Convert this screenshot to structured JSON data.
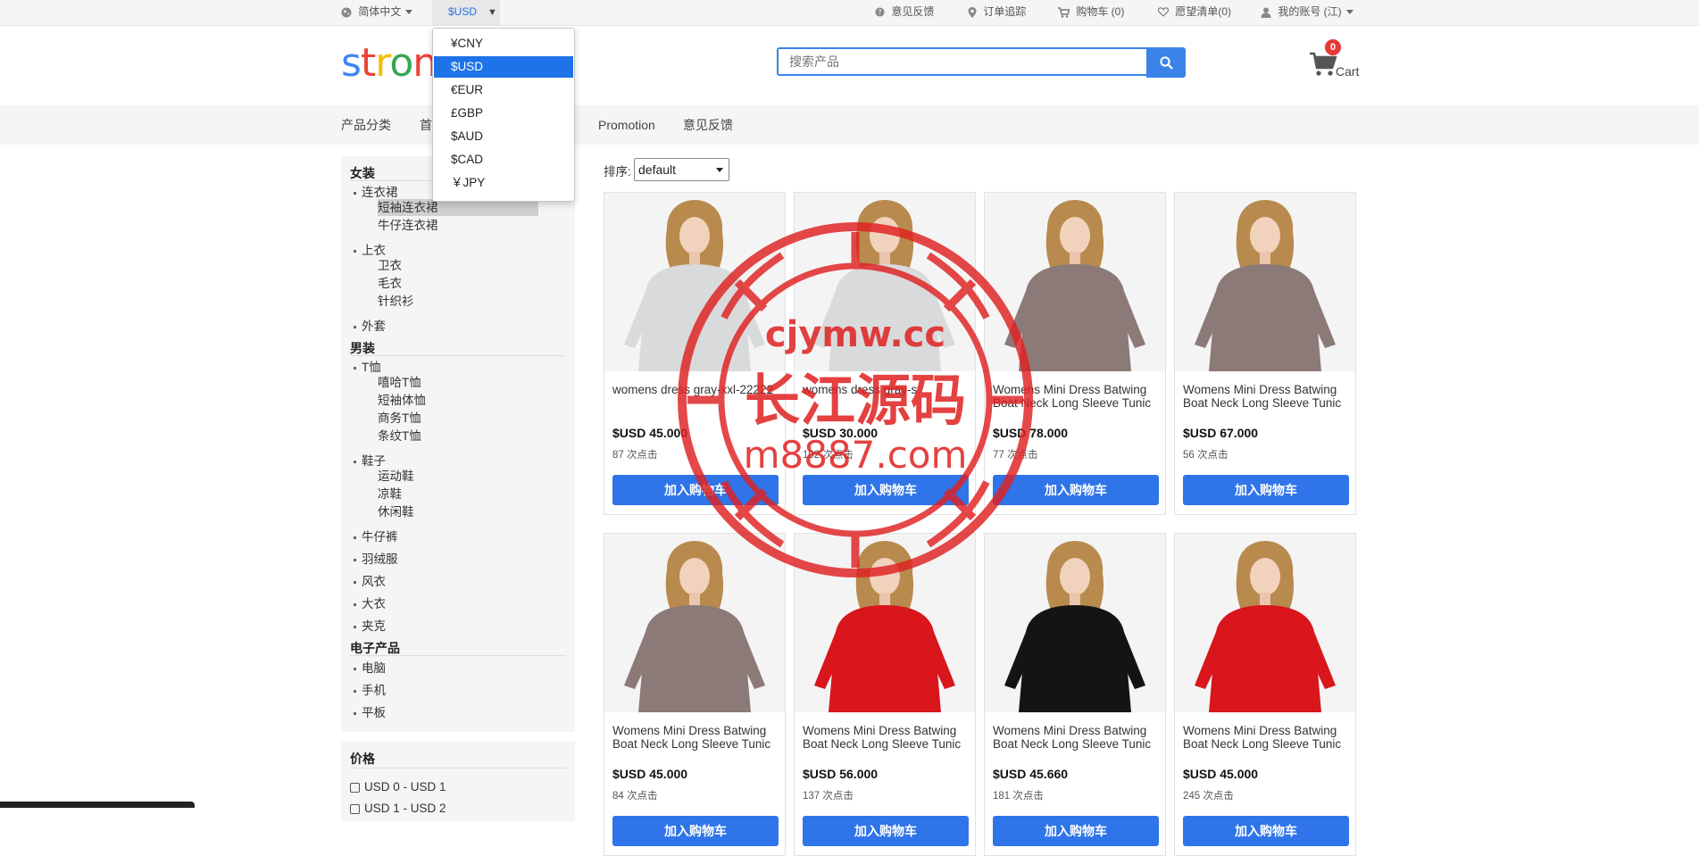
{
  "topbar": {
    "language": "简体中文",
    "currency_current": "$USD",
    "feedback": "意见反馈",
    "order_tracking": "订单追踪",
    "cart": "购物车 (0)",
    "wishlist": "愿望清单(0)",
    "account": "我的账号 (江)"
  },
  "currency_menu": {
    "options": [
      "¥CNY",
      "$USD",
      "€EUR",
      "£GBP",
      "$AUD",
      "$CAD",
      "￥JPY"
    ],
    "selected": "$USD"
  },
  "header": {
    "logo_visible": "strong",
    "search_placeholder": "搜索产品",
    "cart_count": "0",
    "cart_label": "Cart"
  },
  "nav": {
    "items": [
      "产品分类",
      "首",
      "Promotion",
      "意见反馈"
    ]
  },
  "sidebar": {
    "groups": [
      {
        "title": "女装",
        "subs": [
          {
            "name": "连衣裙",
            "leaves": [
              "短袖连衣裙",
              "牛仔连衣裙"
            ]
          },
          {
            "name": "上衣",
            "leaves": [
              "卫衣",
              "毛衣",
              "针织衫"
            ]
          },
          {
            "name": "外套",
            "leaves": []
          }
        ]
      },
      {
        "title": "男装",
        "subs": [
          {
            "name": "T恤",
            "leaves": [
              "嘻哈T恤",
              "短袖体恤",
              "商务T恤",
              "条纹T恤"
            ]
          },
          {
            "name": "鞋子",
            "leaves": [
              "运动鞋",
              "凉鞋",
              "休闲鞋"
            ]
          },
          {
            "name": "牛仔裤",
            "leaves": []
          },
          {
            "name": "羽绒服",
            "leaves": []
          },
          {
            "name": "风衣",
            "leaves": []
          },
          {
            "name": "大衣",
            "leaves": []
          },
          {
            "name": "夹克",
            "leaves": []
          }
        ]
      },
      {
        "title": "电子产品",
        "subs": [
          {
            "name": "电脑",
            "leaves": []
          },
          {
            "name": "手机",
            "leaves": []
          },
          {
            "name": "平板",
            "leaves": []
          }
        ]
      }
    ],
    "active_leaf": "短袖连衣裙",
    "price_title": "价格",
    "price_ranges": [
      "USD 0 - USD 1",
      "USD 1 - USD 2"
    ]
  },
  "sort": {
    "label": "排序:",
    "value": "default"
  },
  "products": [
    {
      "name": "womens dress gray-xxl-22222",
      "price": "$USD 45.000",
      "clicks": "87 次点击",
      "color": "#d9dadc",
      "button": "加入购物车"
    },
    {
      "name": "womens dress gray-s",
      "price": "$USD 30.000",
      "clicks": "102 次点击",
      "color": "#d9dadc",
      "button": "加入购物车"
    },
    {
      "name": "Womens Mini Dress Batwing Boat Neck Long Sleeve Tunic",
      "price": "$USD 78.000",
      "clicks": "77 次点击",
      "color": "#8c7a78",
      "button": "加入购物车"
    },
    {
      "name": "Womens Mini Dress Batwing Boat Neck Long Sleeve Tunic",
      "price": "$USD 67.000",
      "clicks": "56 次点击",
      "color": "#8c7a78",
      "button": "加入购物车"
    },
    {
      "name": "Womens Mini Dress Batwing Boat Neck Long Sleeve Tunic",
      "price": "$USD 45.000",
      "clicks": "84 次点击",
      "color": "#8c7a78",
      "button": "加入购物车"
    },
    {
      "name": "Womens Mini Dress Batwing Boat Neck Long Sleeve Tunic",
      "price": "$USD 56.000",
      "clicks": "137 次点击",
      "color": "#d8161c",
      "button": "加入购物车"
    },
    {
      "name": "Womens Mini Dress Batwing Boat Neck Long Sleeve Tunic",
      "price": "$USD 45.660",
      "clicks": "181 次点击",
      "color": "#141414",
      "button": "加入购物车"
    },
    {
      "name": "Womens Mini Dress Batwing Boat Neck Long Sleeve Tunic",
      "price": "$USD 45.000",
      "clicks": "245 次点击",
      "color": "#d8161c",
      "button": "加入购物车"
    }
  ],
  "watermark": {
    "line1": "cjymw.cc",
    "line2": "长江源码",
    "line3": "m8887.com",
    "color": "#e02020"
  },
  "colors": {
    "accent": "#1e73e8",
    "button": "#2f74e8",
    "badge": "#e53935"
  }
}
